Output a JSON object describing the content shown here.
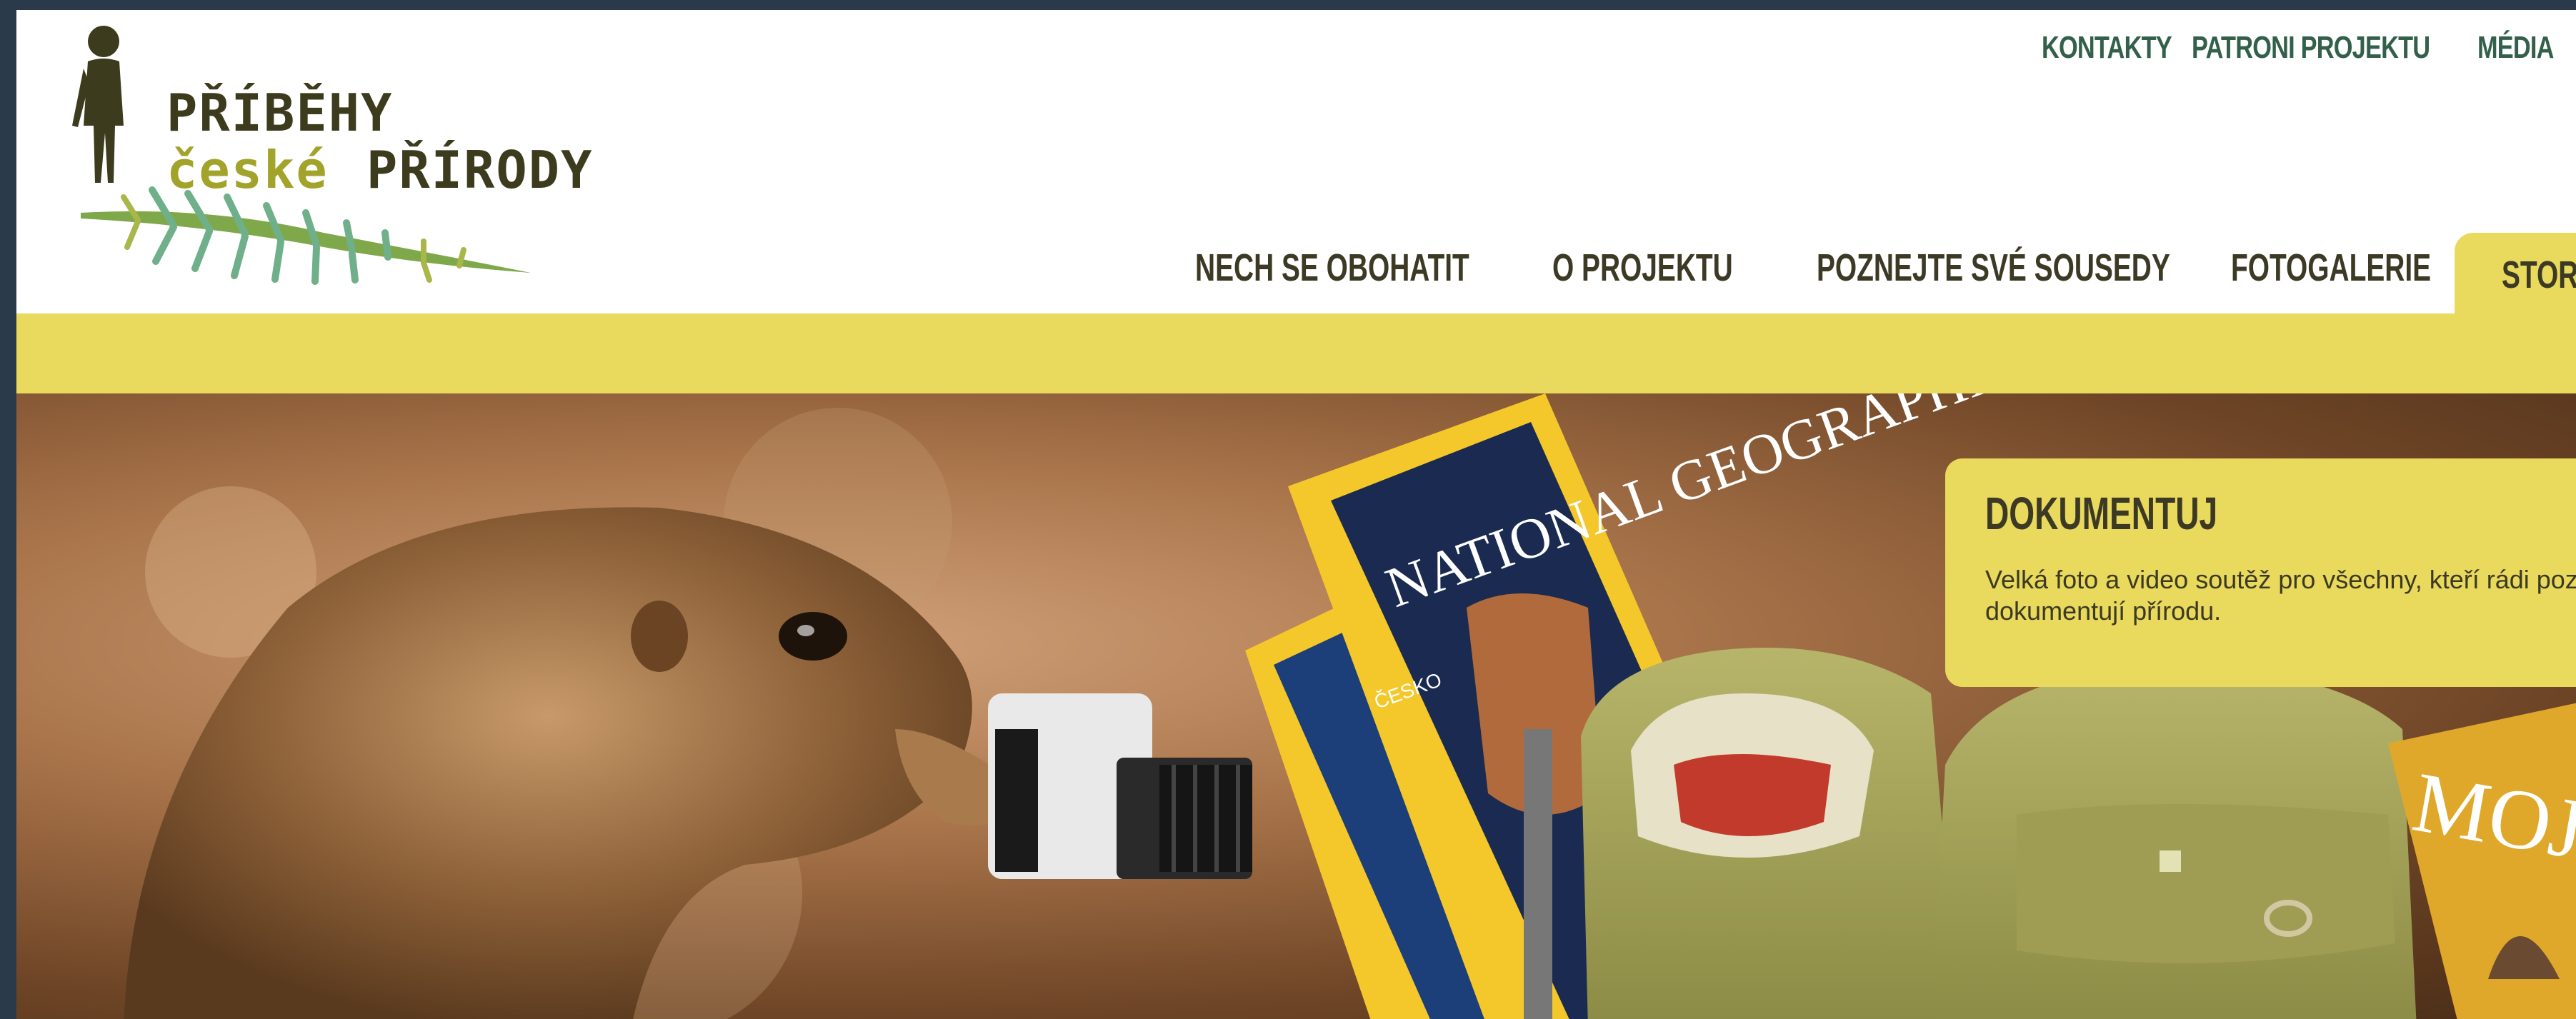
{
  "logo": {
    "line1": "PŘÍBĚHY",
    "line2a": "české",
    "line2b": "PŘÍRODY"
  },
  "top_nav": [
    "KONTAKTY",
    "PATRONI PROJEKTU",
    "MÉDIA"
  ],
  "main_nav": [
    "NECH SE OBOHATIT",
    "O PROJEKTU",
    "POZNEJTE SVÉ SOUSEDY",
    "FOTOGALERIE"
  ],
  "active_tab": "STORY",
  "hero_card": {
    "title": "DOKUMENTUJ",
    "text": "Velká foto a video soutěž pro všechny, kteří rádi pozorují a dokumentují přírodu."
  },
  "magazines": {
    "natgeo_title": "NATIONAL GEOGRAPHIC",
    "natgeo_sub": "ČESKO",
    "moje_title": "MOJE"
  },
  "colors": {
    "accent_yellow": "#e9d95c",
    "nav_green": "#33604b",
    "text_dark": "#3c3a25"
  }
}
